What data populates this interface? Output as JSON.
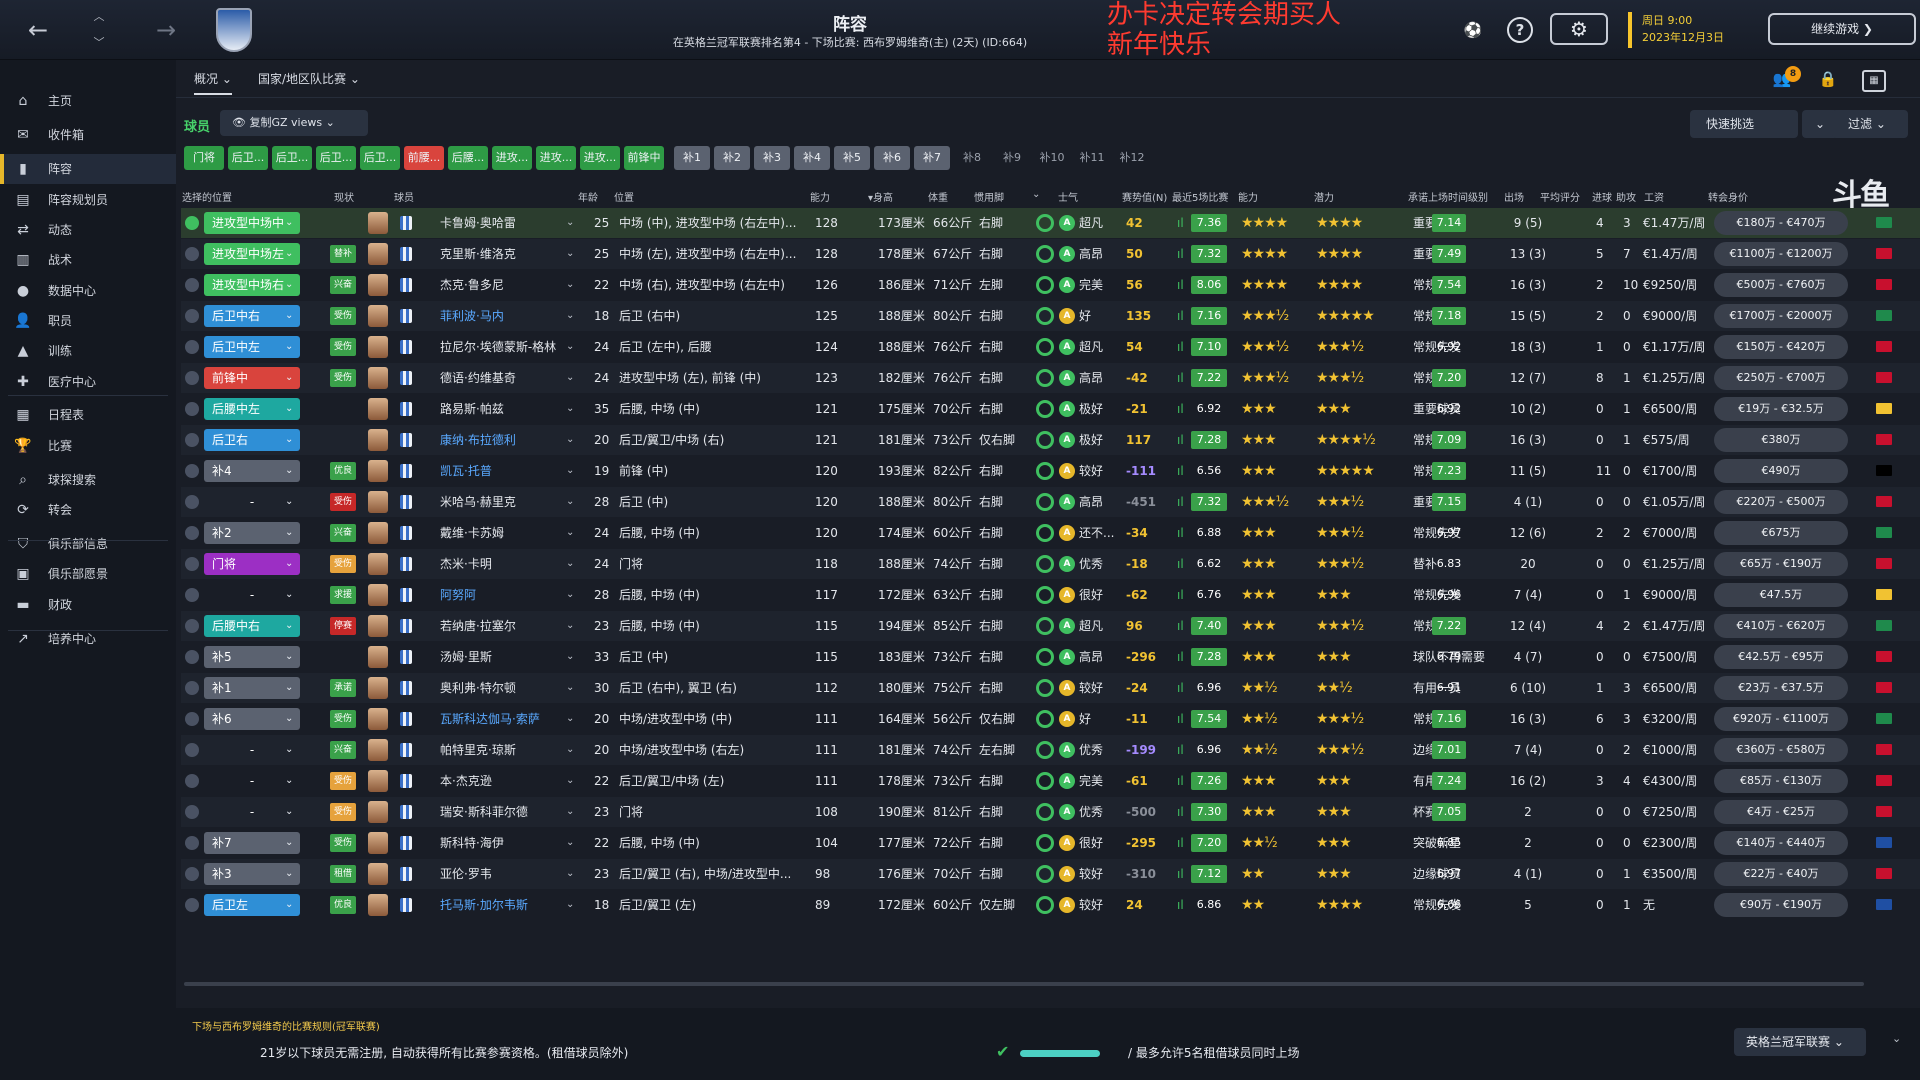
{
  "header": {
    "title": "阵容",
    "subtitle": "在英格兰冠军联赛排名第4 - 下场比赛: 西布罗姆维奇(主) (2天) (ID:664)",
    "overlay_line1": "办卡决定转会期买人",
    "overlay_line2": "新年快乐",
    "date_line1": "周日 9:00",
    "date_line2": "2023年12月3日",
    "continue_label": "继续游戏 ❯",
    "notification_count": "8"
  },
  "sidebar": {
    "items": [
      {
        "label": "主页",
        "icon": "home-icon"
      },
      {
        "label": "收件箱",
        "icon": "inbox-icon"
      },
      {
        "label": "阵容",
        "icon": "squad-icon"
      },
      {
        "label": "阵容规划员",
        "icon": "planner-icon"
      },
      {
        "label": "动态",
        "icon": "dynamics-icon"
      },
      {
        "label": "战术",
        "icon": "tactics-icon"
      },
      {
        "label": "数据中心",
        "icon": "data-hub-icon"
      },
      {
        "label": "职员",
        "icon": "staff-icon"
      },
      {
        "label": "训练",
        "icon": "training-icon"
      },
      {
        "label": "医疗中心",
        "icon": "medical-icon"
      },
      {
        "label": "日程表",
        "icon": "schedule-icon"
      },
      {
        "label": "比赛",
        "icon": "trophy-icon"
      },
      {
        "label": "球探搜索",
        "icon": "scouting-icon"
      },
      {
        "label": "转会",
        "icon": "transfers-icon"
      },
      {
        "label": "俱乐部信息",
        "icon": "club-info-icon"
      },
      {
        "label": "俱乐部愿景",
        "icon": "club-vision-icon"
      },
      {
        "label": "财政",
        "icon": "finances-icon"
      },
      {
        "label": "培养中心",
        "icon": "development-icon"
      }
    ],
    "active_index": 2
  },
  "content_tabs": {
    "overview": "概况",
    "national": "国家/地区队比赛"
  },
  "section": {
    "label": "球员",
    "views_label": "复制GZ views",
    "quick_pick": "快速挑选",
    "filter": "过滤"
  },
  "position_chips": [
    {
      "label": "门将",
      "color": "#2e9b45"
    },
    {
      "label": "后卫...",
      "color": "#2e9b45"
    },
    {
      "label": "后卫...",
      "color": "#2e9b45"
    },
    {
      "label": "后卫...",
      "color": "#2e9b45"
    },
    {
      "label": "后卫...",
      "color": "#2e9b45"
    },
    {
      "label": "前腰...",
      "color": "#d9443d"
    },
    {
      "label": "后腰...",
      "color": "#2e9b45"
    },
    {
      "label": "进攻...",
      "color": "#2e9b45"
    },
    {
      "label": "进攻...",
      "color": "#2e9b45"
    },
    {
      "label": "进攻...",
      "color": "#2e9b45"
    },
    {
      "label": "前锋中",
      "color": "#2e9b45"
    },
    {
      "label": "补1",
      "color": "#5b6270"
    },
    {
      "label": "补2",
      "color": "#5b6270"
    },
    {
      "label": "补3",
      "color": "#5b6270"
    },
    {
      "label": "补4",
      "color": "#5b6270"
    },
    {
      "label": "补5",
      "color": "#5b6270"
    },
    {
      "label": "补6",
      "color": "#5b6270"
    },
    {
      "label": "补7",
      "color": "#5b6270"
    },
    {
      "label": "补8",
      "color": "transparent"
    },
    {
      "label": "补9",
      "color": "transparent"
    },
    {
      "label": "补10",
      "color": "transparent"
    },
    {
      "label": "补11",
      "color": "transparent"
    },
    {
      "label": "补12",
      "color": "transparent"
    }
  ],
  "logo_text": "斗鱼",
  "columns": {
    "selected_pos": "选择的位置",
    "status": "现状",
    "player": "球员",
    "age": "年龄",
    "position": "位置",
    "ability": "能力",
    "height": "▾身高",
    "weight": "体重",
    "foot": "惯用脚",
    "morale": "士气",
    "form_value": "赛势值(N)",
    "recent5": "最近5场比赛",
    "ca": "能力",
    "pa": "潜力",
    "playing_time": "承诺上场时间级别",
    "apps": "出场",
    "avg_rating": "平均评分",
    "goals": "进球",
    "assists": "助攻",
    "wage": "工资",
    "transfer_value": "转会身价"
  },
  "players": [
    {
      "pos": "进攻型中场中",
      "pos_color": "#3fbf60",
      "status": "",
      "status_color": "",
      "name": "卡鲁姆·奥哈雷",
      "age": "25",
      "position": "中场 (中), 进攻型中场 (右左中)...",
      "ability": "128",
      "height": "173厘米",
      "weight": "66公斤",
      "foot": "右脚",
      "morale": "超凡",
      "form": "42",
      "form_color": "#f1c232",
      "recent": "7.36",
      "ca": "★★★★",
      "pa": "★★★★",
      "ptime": "重要球员",
      "apps": "9 (5)",
      "avg": "7.14",
      "avg_color": "#3aa14a",
      "goals": "4",
      "assists": "3",
      "wage": "€1.47万/周",
      "value": "€180万 - €470万",
      "flag": "#1f8a4c",
      "selected": true
    },
    {
      "pos": "进攻型中场左",
      "pos_color": "#3fbf60",
      "status": "替补",
      "status_color": "#3aa14a",
      "name": "克里斯·维洛克",
      "age": "25",
      "position": "中场 (左), 进攻型中场 (右左中)...",
      "ability": "128",
      "height": "178厘米",
      "weight": "67公斤",
      "foot": "右脚",
      "morale": "高昂",
      "form": "50",
      "form_color": "#f1c232",
      "recent": "7.32",
      "ca": "★★★★",
      "pa": "★★★★",
      "ptime": "重要球员",
      "apps": "13 (3)",
      "avg": "7.49",
      "avg_color": "#3aa14a",
      "goals": "5",
      "assists": "7",
      "wage": "€1.4万/周",
      "value": "€1100万 - €1200万",
      "flag": "#c8102e",
      "selected": false
    },
    {
      "pos": "进攻型中场右",
      "pos_color": "#3fbf60",
      "status": "兴奋",
      "status_color": "#3aa14a",
      "name": "杰克·鲁多尼",
      "age": "22",
      "position": "中场 (右), 进攻型中场 (右左中)",
      "ability": "126",
      "height": "186厘米",
      "weight": "71公斤",
      "foot": "左脚",
      "morale": "完美",
      "form": "56",
      "form_color": "#f1c232",
      "recent": "8.06",
      "ca": "★★★★",
      "pa": "★★★★",
      "ptime": "常规先发",
      "apps": "16 (3)",
      "avg": "7.54",
      "avg_color": "#3aa14a",
      "goals": "2",
      "assists": "10",
      "wage": "€9250/周",
      "value": "€500万 - €760万",
      "flag": "#c8102e",
      "selected": false
    },
    {
      "pos": "后卫中右",
      "pos_color": "#2f8fd6",
      "status": "受伤",
      "status_color": "#3aa14a",
      "name": "菲利波·马内",
      "age": "18",
      "position": "后卫 (右中)",
      "ability": "125",
      "height": "188厘米",
      "weight": "80公斤",
      "foot": "右脚",
      "morale": "好",
      "form": "135",
      "form_color": "#f1c232",
      "recent": "7.16",
      "ca": "★★★½",
      "pa": "★★★★★",
      "ptime": "常规先发",
      "apps": "15 (5)",
      "avg": "7.18",
      "avg_color": "#3aa14a",
      "goals": "2",
      "assists": "0",
      "wage": "€9000/周",
      "value": "€1700万 - €2000万",
      "flag": "#1f8a4c",
      "selected": false,
      "loan": true
    },
    {
      "pos": "后卫中左",
      "pos_color": "#2f8fd6",
      "status": "受伤",
      "status_color": "#3aa14a",
      "name": "拉尼尔·埃德蒙斯-格林",
      "age": "24",
      "position": "后卫 (左中), 后腰",
      "ability": "124",
      "height": "188厘米",
      "weight": "76公斤",
      "foot": "右脚",
      "morale": "超凡",
      "form": "54",
      "form_color": "#f1c232",
      "recent": "7.10",
      "ca": "★★★½",
      "pa": "★★★½",
      "ptime": "常规先发",
      "apps": "18 (3)",
      "avg": "6.92",
      "avg_color": "transparent",
      "goals": "1",
      "assists": "0",
      "wage": "€1.17万/周",
      "value": "€150万 - €420万",
      "flag": "#c8102e",
      "selected": false
    },
    {
      "pos": "前锋中",
      "pos_color": "#d9443d",
      "status": "受伤",
      "status_color": "#3aa14a",
      "name": "德语·约维基奇",
      "age": "24",
      "position": "进攻型中场 (左), 前锋 (中)",
      "ability": "123",
      "height": "182厘米",
      "weight": "76公斤",
      "foot": "右脚",
      "morale": "高昂",
      "form": "-42",
      "form_color": "#f1c232",
      "recent": "7.22",
      "ca": "★★★½",
      "pa": "★★★½",
      "ptime": "常规先发",
      "apps": "12 (7)",
      "avg": "7.20",
      "avg_color": "#3aa14a",
      "goals": "8",
      "assists": "1",
      "wage": "€1.25万/周",
      "value": "€250万 - €700万",
      "flag": "#c8102e",
      "selected": false
    },
    {
      "pos": "后腰中左",
      "pos_color": "#1ea8a0",
      "status": "",
      "status_color": "",
      "name": "路易斯·帕兹",
      "age": "35",
      "position": "后腰, 中场 (中)",
      "ability": "121",
      "height": "175厘米",
      "weight": "70公斤",
      "foot": "右脚",
      "morale": "极好",
      "form": "-21",
      "form_color": "#f1c232",
      "recent": "6.92",
      "ca": "★★★",
      "pa": "★★★",
      "ptime": "重要球员",
      "apps": "10 (2)",
      "avg": "6.92",
      "avg_color": "transparent",
      "goals": "0",
      "assists": "1",
      "wage": "€6500/周",
      "value": "€19万 - €32.5万",
      "flag": "#f1c232",
      "selected": false
    },
    {
      "pos": "后卫右",
      "pos_color": "#2f8fd6",
      "status": "",
      "status_color": "",
      "name": "康纳·布拉德利",
      "age": "20",
      "position": "后卫/翼卫/中场 (右)",
      "ability": "121",
      "height": "181厘米",
      "weight": "73公斤",
      "foot": "仅右脚",
      "morale": "极好",
      "form": "117",
      "form_color": "#f1c232",
      "recent": "7.28",
      "ca": "★★★",
      "pa": "★★★★½",
      "ptime": "常规先发",
      "apps": "16 (3)",
      "avg": "7.09",
      "avg_color": "#3aa14a",
      "goals": "0",
      "assists": "1",
      "wage": "€575/周",
      "value": "€380万",
      "flag": "#c8102e",
      "selected": false,
      "loan": true
    },
    {
      "pos": "补4",
      "pos_color": "#5b6270",
      "status": "优良",
      "status_color": "#3aa14a",
      "name": "凯瓦·托普",
      "age": "19",
      "position": "前锋 (中)",
      "ability": "120",
      "height": "193厘米",
      "weight": "82公斤",
      "foot": "右脚",
      "morale": "较好",
      "form": "-111",
      "form_color": "#a58bff",
      "recent": "6.56",
      "ca": "★★★",
      "pa": "★★★★★",
      "ptime": "常规先发",
      "apps": "11 (5)",
      "avg": "7.23",
      "avg_color": "#3aa14a",
      "goals": "11",
      "assists": "0",
      "wage": "€1700/周",
      "value": "€490万",
      "flag": "#000000",
      "selected": false,
      "loan": true
    },
    {
      "pos": "-",
      "pos_color": "transparent",
      "status": "受伤",
      "status_color": "#c62828",
      "name": "米哈乌·赫里克",
      "age": "28",
      "position": "后卫 (中)",
      "ability": "120",
      "height": "188厘米",
      "weight": "80公斤",
      "foot": "右脚",
      "morale": "高昂",
      "form": "-451",
      "form_color": "#8a8f99",
      "recent": "7.32",
      "ca": "★★★½",
      "pa": "★★★½",
      "ptime": "重要球员",
      "apps": "4 (1)",
      "avg": "7.15",
      "avg_color": "#3aa14a",
      "goals": "0",
      "assists": "0",
      "wage": "€1.05万/周",
      "value": "€220万 - €500万",
      "flag": "#c8102e",
      "selected": false
    },
    {
      "pos": "补2",
      "pos_color": "#5b6270",
      "status": "兴奋",
      "status_color": "#3aa14a",
      "name": "戴维·卡苏姆",
      "age": "24",
      "position": "后腰, 中场 (中)",
      "ability": "120",
      "height": "174厘米",
      "weight": "60公斤",
      "foot": "右脚",
      "morale": "还不...",
      "form": "-34",
      "form_color": "#f1c232",
      "recent": "6.88",
      "ca": "★★★",
      "pa": "★★★½",
      "ptime": "常规先发",
      "apps": "12 (6)",
      "avg": "6.97",
      "avg_color": "transparent",
      "goals": "2",
      "assists": "2",
      "wage": "€7000/周",
      "value": "€675万",
      "flag": "#1f8a4c",
      "selected": false
    },
    {
      "pos": "门将",
      "pos_color": "#9c2fc4",
      "status": "受伤",
      "status_color": "#e6a23c",
      "name": "杰米·卡明",
      "age": "24",
      "position": "门将",
      "ability": "118",
      "height": "188厘米",
      "weight": "74公斤",
      "foot": "右脚",
      "morale": "优秀",
      "form": "-18",
      "form_color": "#f1c232",
      "recent": "6.62",
      "ca": "★★★",
      "pa": "★★★½",
      "ptime": "替补",
      "apps": "20",
      "avg": "6.83",
      "avg_color": "transparent",
      "goals": "0",
      "assists": "0",
      "wage": "€1.25万/周",
      "value": "€65万 - €190万",
      "flag": "#c8102e",
      "selected": false
    },
    {
      "pos": "-",
      "pos_color": "transparent",
      "status": "求援",
      "status_color": "#3aa14a",
      "name": "阿努阿",
      "age": "28",
      "position": "后腰, 中场 (中)",
      "ability": "117",
      "height": "172厘米",
      "weight": "63公斤",
      "foot": "右脚",
      "morale": "很好",
      "form": "-62",
      "form_color": "#f1c232",
      "recent": "6.76",
      "ca": "★★★",
      "pa": "★★★",
      "ptime": "常规先发",
      "apps": "7 (4)",
      "avg": "6.96",
      "avg_color": "transparent",
      "goals": "0",
      "assists": "1",
      "wage": "€9000/周",
      "value": "€47.5万",
      "flag": "#f1c232",
      "selected": false,
      "loan": true
    },
    {
      "pos": "后腰中右",
      "pos_color": "#1ea8a0",
      "status": "停赛",
      "status_color": "#c62828",
      "name": "若纳唐·拉塞尔",
      "age": "23",
      "position": "后腰, 中场 (中)",
      "ability": "115",
      "height": "194厘米",
      "weight": "85公斤",
      "foot": "右脚",
      "morale": "超凡",
      "form": "96",
      "form_color": "#f1c232",
      "recent": "7.40",
      "ca": "★★★",
      "pa": "★★★½",
      "ptime": "常规先发",
      "apps": "12 (4)",
      "avg": "7.22",
      "avg_color": "#3aa14a",
      "goals": "4",
      "assists": "2",
      "wage": "€1.47万/周",
      "value": "€410万 - €620万",
      "flag": "#1f8a4c",
      "selected": false
    },
    {
      "pos": "补5",
      "pos_color": "#5b6270",
      "status": "",
      "status_color": "",
      "name": "汤姆·里斯",
      "age": "33",
      "position": "后卫 (中)",
      "ability": "115",
      "height": "183厘米",
      "weight": "73公斤",
      "foot": "右脚",
      "morale": "高昂",
      "form": "-296",
      "form_color": "#f1c232",
      "recent": "7.28",
      "ca": "★★★",
      "pa": "★★★",
      "ptime": "球队不再需要",
      "apps": "4 (7)",
      "avg": "6.79",
      "avg_color": "transparent",
      "goals": "0",
      "assists": "0",
      "wage": "€7500/周",
      "value": "€42.5万 - €95万",
      "flag": "#c8102e",
      "selected": false
    },
    {
      "pos": "补1",
      "pos_color": "#5b6270",
      "status": "承诺",
      "status_color": "#3aa14a",
      "name": "奥利弗·特尔顿",
      "age": "30",
      "position": "后卫 (右中), 翼卫 (右)",
      "ability": "112",
      "height": "180厘米",
      "weight": "75公斤",
      "foot": "右脚",
      "morale": "较好",
      "form": "-24",
      "form_color": "#f1c232",
      "recent": "6.96",
      "ca": "★★½",
      "pa": "★★½",
      "ptime": "有用一员",
      "apps": "6 (10)",
      "avg": "6.91",
      "avg_color": "transparent",
      "goals": "1",
      "assists": "3",
      "wage": "€6500/周",
      "value": "€23万 - €37.5万",
      "flag": "#c8102e",
      "selected": false
    },
    {
      "pos": "补6",
      "pos_color": "#5b6270",
      "status": "受伤",
      "status_color": "#3aa14a",
      "name": "瓦斯科达伽马·索萨",
      "age": "20",
      "position": "中场/进攻型中场 (中)",
      "ability": "111",
      "height": "164厘米",
      "weight": "56公斤",
      "foot": "仅右脚",
      "morale": "好",
      "form": "-11",
      "form_color": "#f1c232",
      "recent": "7.54",
      "ca": "★★½",
      "pa": "★★★½",
      "ptime": "常规先发",
      "apps": "16 (3)",
      "avg": "7.16",
      "avg_color": "#3aa14a",
      "goals": "6",
      "assists": "3",
      "wage": "€3200/周",
      "value": "€920万 - €1100万",
      "flag": "#1f8a4c",
      "selected": false,
      "loan": true
    },
    {
      "pos": "-",
      "pos_color": "transparent",
      "status": "兴奋",
      "status_color": "#3aa14a",
      "name": "帕特里克·琼斯",
      "age": "20",
      "position": "中场/进攻型中场 (右左)",
      "ability": "111",
      "height": "181厘米",
      "weight": "74公斤",
      "foot": "左右脚",
      "morale": "优秀",
      "form": "-199",
      "form_color": "#a58bff",
      "recent": "6.96",
      "ca": "★★½",
      "pa": "★★★½",
      "ptime": "边缘球员",
      "apps": "7 (4)",
      "avg": "7.01",
      "avg_color": "#3aa14a",
      "goals": "0",
      "assists": "2",
      "wage": "€1000/周",
      "value": "€360万 - €580万",
      "flag": "#c8102e",
      "selected": false
    },
    {
      "pos": "-",
      "pos_color": "transparent",
      "status": "受伤",
      "status_color": "#e6a23c",
      "name": "本·杰克逊",
      "age": "22",
      "position": "后卫/翼卫/中场 (左)",
      "ability": "111",
      "height": "178厘米",
      "weight": "73公斤",
      "foot": "右脚",
      "morale": "完美",
      "form": "-61",
      "form_color": "#f1c232",
      "recent": "7.26",
      "ca": "★★★",
      "pa": "★★★",
      "ptime": "有用一员",
      "apps": "16 (2)",
      "avg": "7.24",
      "avg_color": "#3aa14a",
      "goals": "3",
      "assists": "4",
      "wage": "€4300/周",
      "value": "€85万 - €130万",
      "flag": "#c8102e",
      "selected": false
    },
    {
      "pos": "-",
      "pos_color": "transparent",
      "status": "受伤",
      "status_color": "#e6a23c",
      "name": "瑞安·斯科菲尔德",
      "age": "23",
      "position": "门将",
      "ability": "108",
      "height": "190厘米",
      "weight": "81公斤",
      "foot": "右脚",
      "morale": "优秀",
      "form": "-500",
      "form_color": "#8a8f99",
      "recent": "7.30",
      "ca": "★★★",
      "pa": "★★★",
      "ptime": "杯赛门将",
      "apps": "2",
      "avg": "7.05",
      "avg_color": "#3aa14a",
      "goals": "0",
      "assists": "0",
      "wage": "€7250/周",
      "value": "€4万 - €25万",
      "flag": "#c8102e",
      "selected": false
    },
    {
      "pos": "补7",
      "pos_color": "#5b6270",
      "status": "受伤",
      "status_color": "#3aa14a",
      "name": "斯科特·海伊",
      "age": "22",
      "position": "后腰, 中场 (中)",
      "ability": "104",
      "height": "177厘米",
      "weight": "72公斤",
      "foot": "右脚",
      "morale": "很好",
      "form": "-295",
      "form_color": "#f1c232",
      "recent": "7.20",
      "ca": "★★½",
      "pa": "★★★",
      "ptime": "突破新星",
      "apps": "2",
      "avg": "6.85",
      "avg_color": "transparent",
      "goals": "0",
      "assists": "0",
      "wage": "€2300/周",
      "value": "€140万 - €440万",
      "flag": "#1f4fa3",
      "selected": false
    },
    {
      "pos": "补3",
      "pos_color": "#5b6270",
      "status": "租借",
      "status_color": "#3aa14a",
      "name": "亚伦·罗韦",
      "age": "23",
      "position": "后卫/翼卫 (右), 中场/进攻型中...",
      "ability": "98",
      "height": "176厘米",
      "weight": "70公斤",
      "foot": "右脚",
      "morale": "较好",
      "form": "-310",
      "form_color": "#8a8f99",
      "recent": "7.12",
      "ca": "★★",
      "pa": "★★★",
      "ptime": "边缘球员",
      "apps": "4 (1)",
      "avg": "6.97",
      "avg_color": "transparent",
      "goals": "0",
      "assists": "1",
      "wage": "€3500/周",
      "value": "€22万 - €40万",
      "flag": "#c8102e",
      "selected": false
    },
    {
      "pos": "后卫左",
      "pos_color": "#2f8fd6",
      "status": "优良",
      "status_color": "#3aa14a",
      "name": "托马斯·加尔韦斯",
      "age": "18",
      "position": "后卫/翼卫 (左)",
      "ability": "89",
      "height": "172厘米",
      "weight": "60公斤",
      "foot": "仅左脚",
      "morale": "较好",
      "form": "24",
      "form_color": "#f1c232",
      "recent": "6.86",
      "ca": "★★",
      "pa": "★★★★",
      "ptime": "常规先发",
      "apps": "5",
      "avg": "6.66",
      "avg_color": "transparent",
      "goals": "0",
      "assists": "1",
      "wage": "无",
      "value": "€90万 - €190万",
      "flag": "#1f4fa3",
      "selected": false,
      "loan": true
    }
  ],
  "footer": {
    "title": "下场与西布罗姆维奇的比赛规则(冠军联赛)",
    "message": "21岁以下球员无需注册, 自动获得所有比赛参赛资格。(租借球员除外)",
    "message2": "/ 最多允许5名租借球员同时上场",
    "league": "英格兰冠军联赛"
  }
}
